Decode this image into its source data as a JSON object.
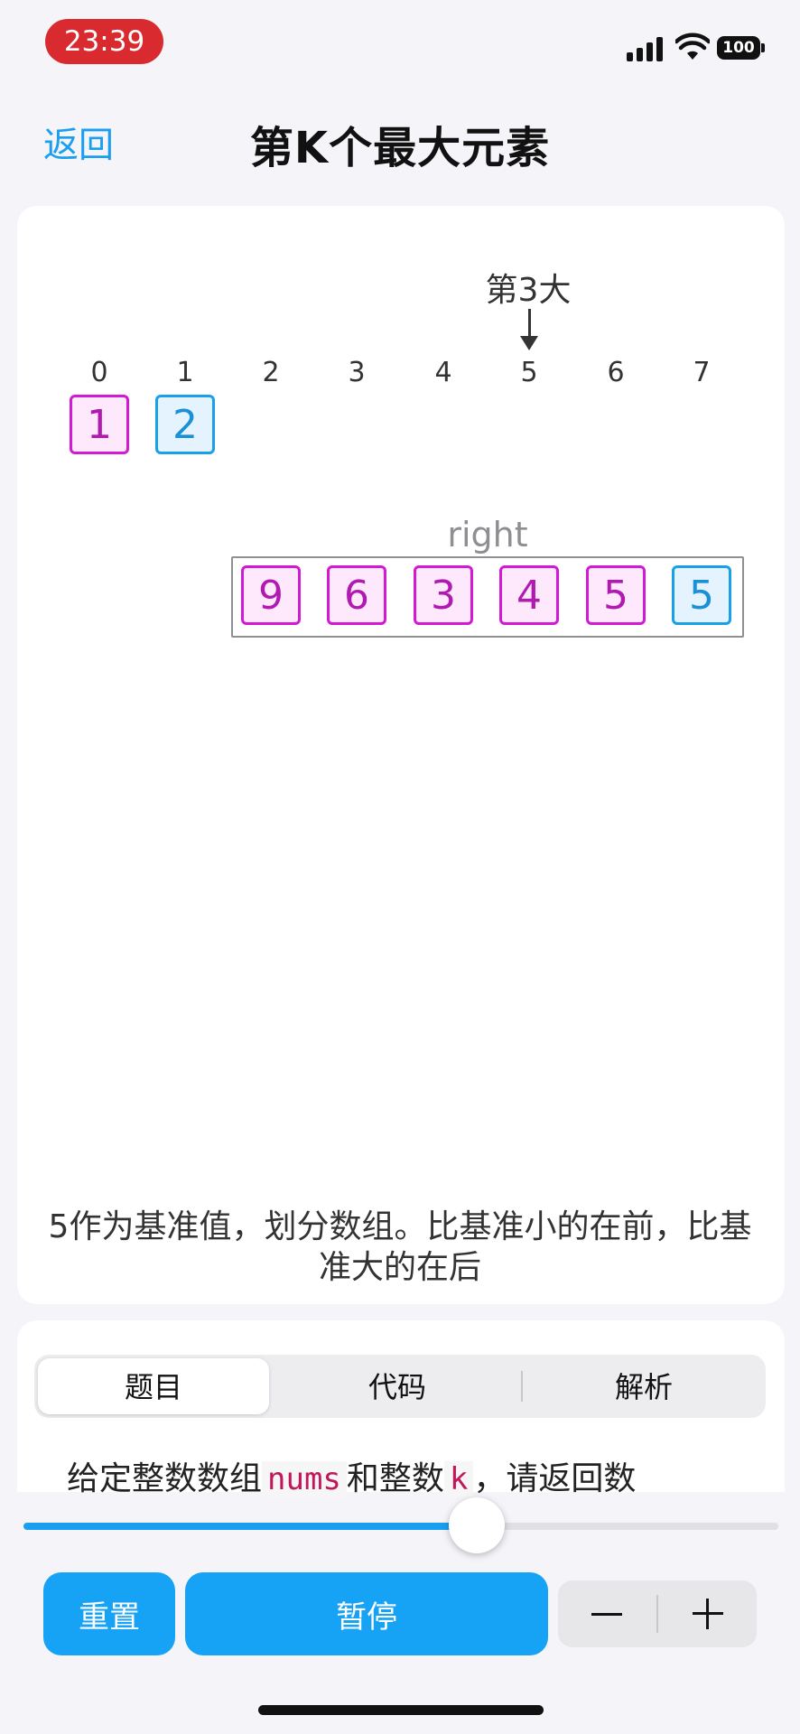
{
  "status_bar": {
    "time": "23:39",
    "battery": "100"
  },
  "nav": {
    "back_label": "返回",
    "title": "第K个最大元素"
  },
  "visualization": {
    "annotation": "第3大",
    "indices": [
      "0",
      "1",
      "2",
      "3",
      "4",
      "5",
      "6",
      "7"
    ],
    "top_cells": [
      {
        "value": "1",
        "color": "magenta"
      },
      {
        "value": "2",
        "color": "blue"
      }
    ],
    "partition_label": "right",
    "partition_cells": [
      {
        "value": "9",
        "color": "magenta"
      },
      {
        "value": "6",
        "color": "magenta"
      },
      {
        "value": "3",
        "color": "magenta"
      },
      {
        "value": "4",
        "color": "magenta"
      },
      {
        "value": "5",
        "color": "magenta"
      },
      {
        "value": "5",
        "color": "blue"
      }
    ],
    "caption": "5作为基准值，划分数组。比基准小的在前，比基准大的在后"
  },
  "tabs": [
    {
      "label": "题目",
      "active": true
    },
    {
      "label": "代码",
      "active": false
    },
    {
      "label": "解析",
      "active": false
    }
  ],
  "description": {
    "prefix": "给定整数数组",
    "code1": "nums",
    "middle": "和整数",
    "code2": "k",
    "suffix": "，请返回数"
  },
  "progress": {
    "value_percent": 60
  },
  "controls": {
    "reset_label": "重置",
    "pause_label": "暂停"
  },
  "colors": {
    "accent": "#1a9ff0",
    "magenta": "#d21ad2",
    "blue": "#1aa0e6",
    "status_red": "#d92b2f"
  }
}
